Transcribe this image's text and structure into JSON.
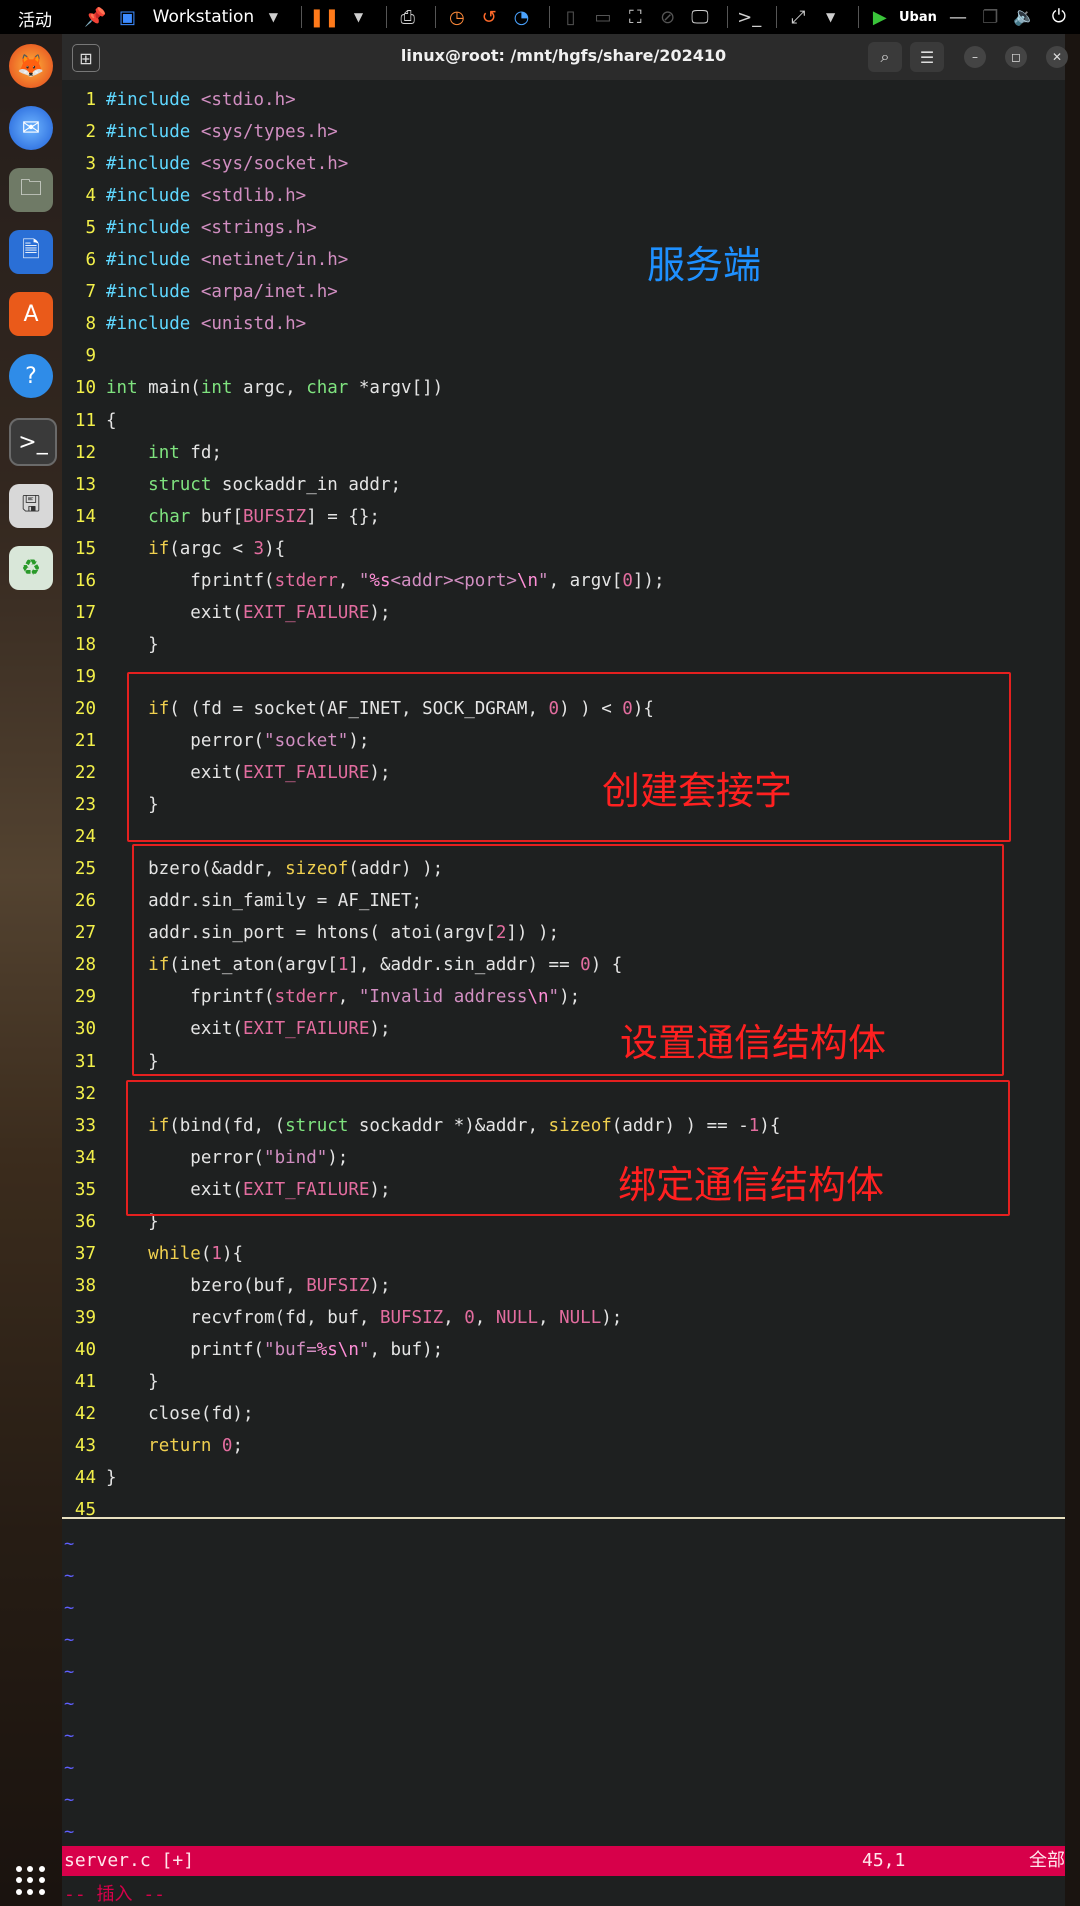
{
  "topbar": {
    "activities": "活动",
    "vm_title": "Workstation",
    "vm_tab_label": "Uban"
  },
  "terminal": {
    "title": "linux@root: /mnt/hgfs/share/202410"
  },
  "code_lines": [
    {
      "n": "1",
      "html": "<span class='kw-inc'>#include</span> <span class='hdr'>&lt;stdio.h&gt;</span>"
    },
    {
      "n": "2",
      "html": "<span class='kw-inc'>#include</span> <span class='hdr'>&lt;sys/types.h&gt;</span>"
    },
    {
      "n": "3",
      "html": "<span class='kw-inc'>#include</span> <span class='hdr'>&lt;sys/socket.h&gt;</span>"
    },
    {
      "n": "4",
      "html": "<span class='kw-inc'>#include</span> <span class='hdr'>&lt;stdlib.h&gt;</span>"
    },
    {
      "n": "5",
      "html": "<span class='kw-inc'>#include</span> <span class='hdr'>&lt;strings.h&gt;</span>"
    },
    {
      "n": "6",
      "html": "<span class='kw-inc'>#include</span> <span class='hdr'>&lt;netinet/in.h&gt;</span>"
    },
    {
      "n": "7",
      "html": "<span class='kw-inc'>#include</span> <span class='hdr'>&lt;arpa/inet.h&gt;</span>"
    },
    {
      "n": "8",
      "html": "<span class='kw-inc'>#include</span> <span class='hdr'>&lt;unistd.h&gt;</span>"
    },
    {
      "n": "9",
      "html": ""
    },
    {
      "n": "10",
      "html": "<span class='type'>int</span> main(<span class='type'>int</span> argc, <span class='type'>char</span> *argv[])"
    },
    {
      "n": "11",
      "html": "{"
    },
    {
      "n": "12",
      "html": "    <span class='type'>int</span> fd;"
    },
    {
      "n": "13",
      "html": "    <span class='type'>struct</span> sockaddr_in addr;"
    },
    {
      "n": "14",
      "html": "    <span class='type'>char</span> buf[<span class='const'>BUFSIZ</span>] = {};"
    },
    {
      "n": "15",
      "html": "    <span class='kw'>if</span>(argc &lt; <span class='num'>3</span>){"
    },
    {
      "n": "16",
      "html": "        fprintf(<span class='const'>stderr</span>, <span class='str'>\"</span><span class='esc'>%s</span><span class='str'>&lt;addr&gt;&lt;port&gt;</span><span class='esc'>\\n</span><span class='str'>\"</span>, argv[<span class='num'>0</span>]);"
    },
    {
      "n": "17",
      "html": "        exit(<span class='const'>EXIT_FAILURE</span>);"
    },
    {
      "n": "18",
      "html": "    }"
    },
    {
      "n": "19",
      "html": ""
    },
    {
      "n": "20",
      "html": "    <span class='kw'>if</span>( (fd = socket(AF_INET, SOCK_DGRAM, <span class='num'>0</span>) ) &lt; <span class='num'>0</span>){"
    },
    {
      "n": "21",
      "html": "        perror(<span class='str'>\"socket\"</span>);"
    },
    {
      "n": "22",
      "html": "        exit(<span class='const'>EXIT_FAILURE</span>);"
    },
    {
      "n": "23",
      "html": "    }"
    },
    {
      "n": "24",
      "html": ""
    },
    {
      "n": "25",
      "html": "    bzero(&amp;addr, <span class='kw'>sizeof</span>(addr) );"
    },
    {
      "n": "26",
      "html": "    addr.sin_family = AF_INET;"
    },
    {
      "n": "27",
      "html": "    addr.sin_port = htons( atoi(argv[<span class='num'>2</span>]) );"
    },
    {
      "n": "28",
      "html": "    <span class='kw'>if</span>(inet_aton(argv[<span class='num'>1</span>], &amp;addr.sin_addr) == <span class='num'>0</span>) {"
    },
    {
      "n": "29",
      "html": "        fprintf(<span class='const'>stderr</span>, <span class='str'>\"Invalid address</span><span class='esc'>\\n</span><span class='str'>\"</span>);"
    },
    {
      "n": "30",
      "html": "        exit(<span class='const'>EXIT_FAILURE</span>);"
    },
    {
      "n": "31",
      "html": "    }"
    },
    {
      "n": "32",
      "html": ""
    },
    {
      "n": "33",
      "html": "    <span class='kw'>if</span>(bind(fd, (<span class='type'>struct</span> sockaddr *)&amp;addr, <span class='kw'>sizeof</span>(addr) ) == -<span class='num'>1</span>){"
    },
    {
      "n": "34",
      "html": "        perror(<span class='str'>\"bind\"</span>);"
    },
    {
      "n": "35",
      "html": "        exit(<span class='const'>EXIT_FAILURE</span>);"
    },
    {
      "n": "36",
      "html": "    }"
    },
    {
      "n": "37",
      "html": "    <span class='kw'>while</span>(<span class='num'>1</span>){"
    },
    {
      "n": "38",
      "html": "        bzero(buf, <span class='const'>BUFSIZ</span>);"
    },
    {
      "n": "39",
      "html": "        recvfrom(fd, buf, <span class='const'>BUFSIZ</span>, <span class='num'>0</span>, <span class='const'>NULL</span>, <span class='const'>NULL</span>);"
    },
    {
      "n": "40",
      "html": "        printf(<span class='str'>\"buf=</span><span class='esc'>%s\\n</span><span class='str'>\"</span>, buf);"
    },
    {
      "n": "41",
      "html": "    }"
    },
    {
      "n": "42",
      "html": "    close(fd);"
    },
    {
      "n": "43",
      "html": "    <span class='kw'>return</span> <span class='num'>0</span>;"
    },
    {
      "n": "44",
      "html": "}"
    },
    {
      "n": "45",
      "html": ""
    }
  ],
  "annotations": {
    "server": "服务端",
    "create_socket": "创建套接字",
    "set_struct": "设置通信结构体",
    "bind_struct": "绑定通信结构体"
  },
  "tilde": "~",
  "statusbar": {
    "file": "server.c [+]",
    "position": "45,1",
    "scroll": "全部"
  },
  "mode": "-- 插入 --",
  "colors": {
    "annotation_red": "#e5201f",
    "annotation_blue": "#1e90ff",
    "status_bg": "#d7004a"
  }
}
